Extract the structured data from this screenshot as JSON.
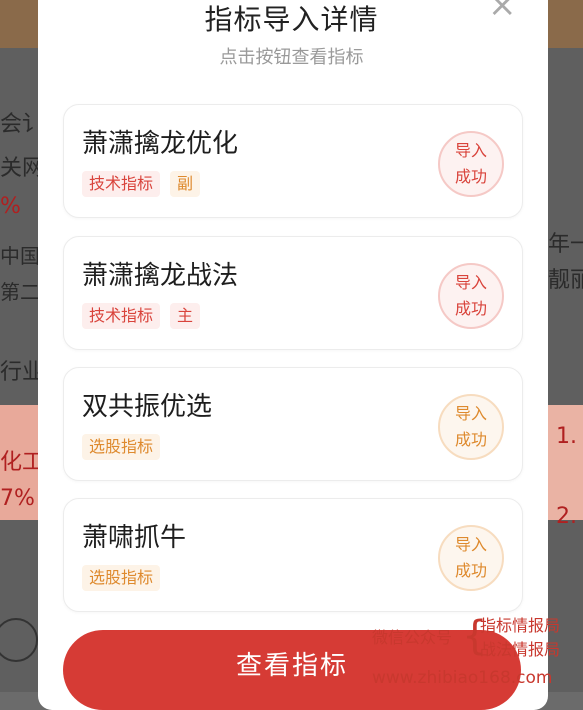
{
  "dialog": {
    "title": "指标导入详情",
    "subtitle": "点击按钮查看指标",
    "close_glyph": "×"
  },
  "indicators": [
    {
      "name": "萧潇擒龙优化",
      "tags": [
        {
          "text": "技术指标",
          "style": "red"
        },
        {
          "text": "副",
          "style": "orange"
        }
      ],
      "status_line1": "导入",
      "status_line2": "成功",
      "status_style": "red"
    },
    {
      "name": "萧潇擒龙战法",
      "tags": [
        {
          "text": "技术指标",
          "style": "red"
        },
        {
          "text": "主",
          "style": "red"
        }
      ],
      "status_line1": "导入",
      "status_line2": "成功",
      "status_style": "red"
    },
    {
      "name": "双共振优选",
      "tags": [
        {
          "text": "选股指标",
          "style": "orange"
        }
      ],
      "status_line1": "导入",
      "status_line2": "成功",
      "status_style": "orange"
    },
    {
      "name": "萧啸抓牛",
      "tags": [
        {
          "text": "选股指标",
          "style": "orange"
        }
      ],
      "status_line1": "导入",
      "status_line2": "成功",
      "status_style": "orange"
    }
  ],
  "primary_button": {
    "label": "查看指标"
  },
  "watermark": {
    "left_label": "微信公众号",
    "line1": "指标情报局",
    "line2": "战法情报局",
    "url": "www.zhibiao168.com"
  },
  "background": {
    "t1": "会讠",
    "t2": "关网",
    "t3": "%",
    "t4": "中国",
    "t5": "第二",
    "t6": "行业",
    "t7": "化工",
    "t8": "7%",
    "r1": "年一",
    "r2": "靓丽",
    "r3": "1.",
    "r4": "2."
  },
  "colors": {
    "accent": "#d63b35",
    "orange": "#de8a2e"
  }
}
